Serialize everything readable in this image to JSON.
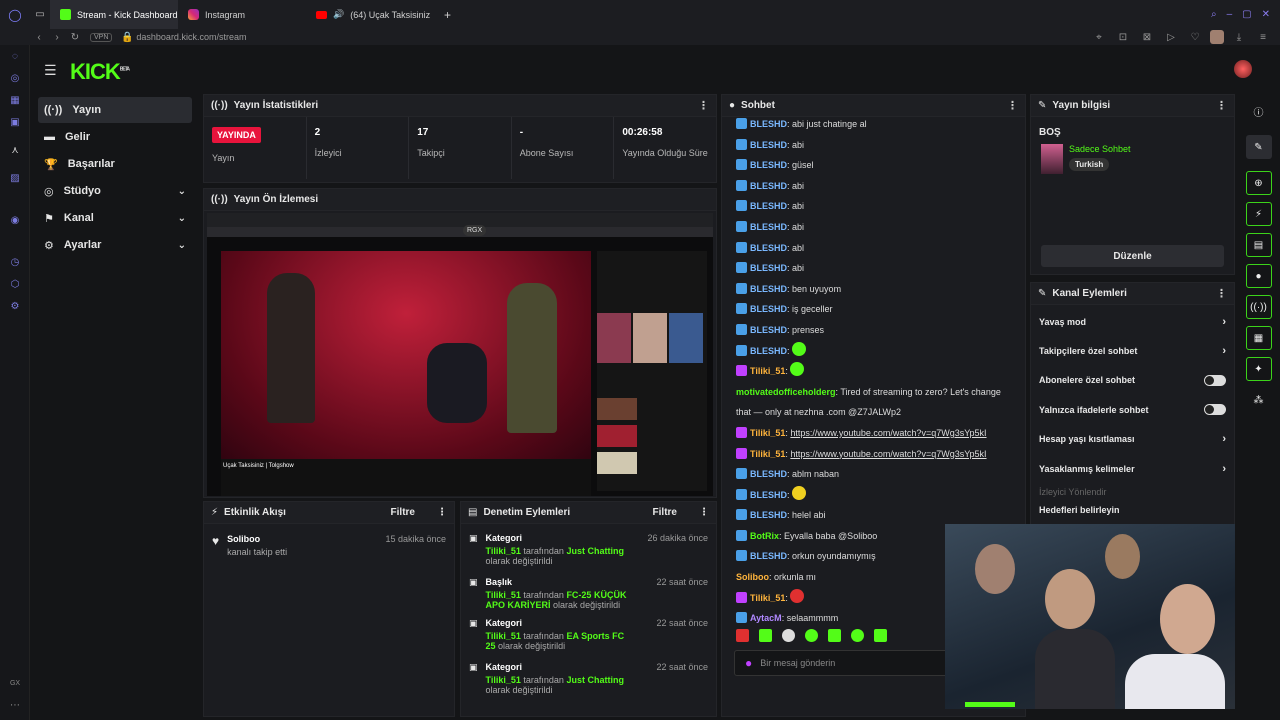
{
  "browser": {
    "tabs": [
      {
        "title": "Stream - Kick Dashboard",
        "icon": "kick-favicon"
      },
      {
        "title": "Instagram",
        "icon": "instagram-favicon"
      },
      {
        "title": "(64) Uçak Taksisiniz",
        "icon": "youtube-favicon"
      }
    ],
    "new_tab": "+",
    "vpn": "VPN",
    "url": "dashboard.kick.com/stream"
  },
  "app": {
    "logo": "KICK",
    "beta": "BETA"
  },
  "sidebar": {
    "items": [
      {
        "label": "Yayın",
        "icon": "broadcast-icon"
      },
      {
        "label": "Gelir",
        "icon": "wallet-icon"
      },
      {
        "label": "Başarılar",
        "icon": "trophy-icon"
      },
      {
        "label": "Stüdyo",
        "icon": "studio-icon"
      },
      {
        "label": "Kanal",
        "icon": "channel-icon"
      },
      {
        "label": "Ayarlar",
        "icon": "gear-icon"
      }
    ]
  },
  "stats": {
    "title": "Yayın İstatistikleri",
    "live_badge": "YAYINDA",
    "items": [
      {
        "value": "",
        "label": "Yayın"
      },
      {
        "value": "2",
        "label": "İzleyici"
      },
      {
        "value": "17",
        "label": "Takipçi"
      },
      {
        "value": "-",
        "label": "Abone Sayısı"
      },
      {
        "value": "00:26:58",
        "label": "Yayında Olduğu Süre"
      }
    ]
  },
  "preview": {
    "title": "Yayın Ön İzlemesi",
    "video_title": "Uçak Taksisiniz | Tolgshow",
    "overlay": "RGX"
  },
  "activity": {
    "title": "Etkinlik Akışı",
    "filter": "Filtre",
    "items": [
      {
        "user": "Soliboo",
        "text": "kanalı takip etti",
        "time": "15 dakika önce"
      }
    ]
  },
  "moderation": {
    "title": "Denetim Eylemleri",
    "filter": "Filtre",
    "items": [
      {
        "type": "Kategori",
        "user": "Tiliki_51",
        "mid": "tarafından",
        "target": "Just Chatting",
        "tail": "olarak değiştirildi",
        "time": "26 dakika önce"
      },
      {
        "type": "Başlık",
        "user": "Tiliki_51",
        "mid": "tarafından",
        "target": "FC-25 KÜÇÜK APO KARİYERİ",
        "tail": "olarak değiştirildi",
        "time": "22 saat önce"
      },
      {
        "type": "Kategori",
        "user": "Tiliki_51",
        "mid": "tarafından",
        "target": "EA Sports FC 25",
        "tail": "olarak değiştirildi",
        "time": "22 saat önce"
      },
      {
        "type": "Kategori",
        "user": "Tiliki_51",
        "mid": "tarafından",
        "target": "Just Chatting",
        "tail": "olarak değiştirildi",
        "time": "22 saat önce"
      }
    ]
  },
  "chat": {
    "title": "Sohbet",
    "placeholder": "Bir mesaj gönderin",
    "messages": [
      {
        "user": "BLESHD",
        "color": "#7ab8ff",
        "text": "abi just chatinge al",
        "badge": "#4aa0e8"
      },
      {
        "user": "BLESHD",
        "color": "#7ab8ff",
        "text": "abi",
        "badge": "#4aa0e8"
      },
      {
        "user": "BLESHD",
        "color": "#7ab8ff",
        "text": "güsel",
        "badge": "#4aa0e8"
      },
      {
        "user": "BLESHD",
        "color": "#7ab8ff",
        "text": "abi",
        "badge": "#4aa0e8"
      },
      {
        "user": "BLESHD",
        "color": "#7ab8ff",
        "text": "abi",
        "badge": "#4aa0e8"
      },
      {
        "user": "BLESHD",
        "color": "#7ab8ff",
        "text": "abi",
        "badge": "#4aa0e8"
      },
      {
        "user": "BLESHD",
        "color": "#7ab8ff",
        "text": "abl",
        "badge": "#4aa0e8"
      },
      {
        "user": "BLESHD",
        "color": "#7ab8ff",
        "text": "abi",
        "badge": "#4aa0e8"
      },
      {
        "user": "BLESHD",
        "color": "#7ab8ff",
        "text": "ben uyuyom",
        "badge": "#4aa0e8"
      },
      {
        "user": "BLESHD",
        "color": "#7ab8ff",
        "text": "iş geceller",
        "badge": "#4aa0e8"
      },
      {
        "user": "BLESHD",
        "color": "#7ab8ff",
        "text": "prenses",
        "badge": "#4aa0e8"
      },
      {
        "user": "BLESHD",
        "color": "#7ab8ff",
        "text": "",
        "emote": "#53fc18",
        "badge": "#4aa0e8"
      },
      {
        "user": "Tiliki_51",
        "color": "#ffb43c",
        "text": "",
        "emote": "#53fc18",
        "badge": "#c040ff"
      },
      {
        "user": "motivatedofficeholderg",
        "color": "#53fc18",
        "text": "Tired of streaming to zero? Let's change",
        "badge": ""
      },
      {
        "user": "",
        "color": "#ddd",
        "text": "that — only at nezhna .com @Z7JALWp2",
        "badge": ""
      },
      {
        "user": "Tiliki_51",
        "color": "#ffb43c",
        "link": "https://www.youtube.com/watch?v=q7Wg3sYp5kI",
        "text": "",
        "badge": "#c040ff"
      },
      {
        "user": "Tiliki_51",
        "color": "#ffb43c",
        "link": "https://www.youtube.com/watch?v=q7Wg3sYp5kI",
        "text": "",
        "badge": "#c040ff"
      },
      {
        "user": "BLESHD",
        "color": "#7ab8ff",
        "text": "ablm naban",
        "badge": "#4aa0e8"
      },
      {
        "user": "BLESHD",
        "color": "#7ab8ff",
        "text": "",
        "emote": "#f0d020",
        "badge": "#4aa0e8"
      },
      {
        "user": "BLESHD",
        "color": "#7ab8ff",
        "text": "helel abi",
        "badge": "#4aa0e8"
      },
      {
        "user": "BotRix",
        "color": "#53fc18",
        "text": "Eyvalla baba @Soliboo",
        "badge": "#4aa0e8"
      },
      {
        "user": "BLESHD",
        "color": "#7ab8ff",
        "text": "orkun oyundamıymış",
        "badge": "#4aa0e8"
      },
      {
        "user": "Soliboo",
        "color": "#ffb43c",
        "text": "orkunla mı",
        "badge": ""
      },
      {
        "user": "Tiliki_51",
        "color": "#ffb43c",
        "text": "",
        "emote": "#e03030",
        "badge": "#c040ff"
      },
      {
        "user": "AytacM",
        "color": "#b088ff",
        "text": "selaammmm",
        "badge": "#4aa0e8"
      }
    ]
  },
  "stream_info": {
    "title": "Yayın bilgisi",
    "stream_title": "BOŞ",
    "category": "Sadece Sohbet",
    "language": "Turkish",
    "edit": "Düzenle"
  },
  "channel_actions": {
    "title": "Kanal Eylemleri",
    "items": [
      {
        "label": "Yavaş mod",
        "control": "arrow"
      },
      {
        "label": "Takipçilere özel sohbet",
        "control": "arrow"
      },
      {
        "label": "Abonelere özel sohbet",
        "control": "toggle"
      },
      {
        "label": "Yalnızca ifadelerle sohbet",
        "control": "toggle"
      },
      {
        "label": "Hesap yaşı kısıtlaması",
        "control": "arrow"
      },
      {
        "label": "Yasaklanmış kelimeler",
        "control": "arrow"
      }
    ],
    "muted": "İzleyici Yönlendir",
    "cut": "Hedefleri belirleyin"
  },
  "colors": {
    "accent": "#53fc18",
    "live": "#e8143c",
    "panel": "#1b1c20"
  }
}
